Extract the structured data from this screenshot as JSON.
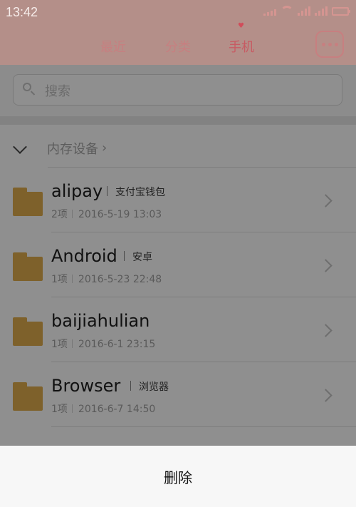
{
  "status_bar": {
    "time": "13:42"
  },
  "tabs": [
    {
      "label": "最近",
      "active": false
    },
    {
      "label": "分类",
      "active": false
    },
    {
      "label": "手机",
      "active": true
    }
  ],
  "search": {
    "placeholder": "搜索"
  },
  "breadcrumb": {
    "label": "内存设备"
  },
  "files": [
    {
      "name": "alipay",
      "alias": "支付宝钱包",
      "count": "2项",
      "date": "2016-5-19 13:03"
    },
    {
      "name": "Android",
      "alias": "安卓",
      "count": "1项",
      "date": "2016-5-23 22:48"
    },
    {
      "name": "baijiahulian",
      "alias": "",
      "count": "1项",
      "date": "2016-6-1 23:15"
    },
    {
      "name": "Browser",
      "alias": "浏览器",
      "count": "1项",
      "date": "2016-6-7 14:50"
    }
  ],
  "bottom_sheet": {
    "delete_label": "删除"
  },
  "colors": {
    "accent": "#c75b63",
    "header_bg": "#b48f89",
    "folder": "#7e612b"
  }
}
